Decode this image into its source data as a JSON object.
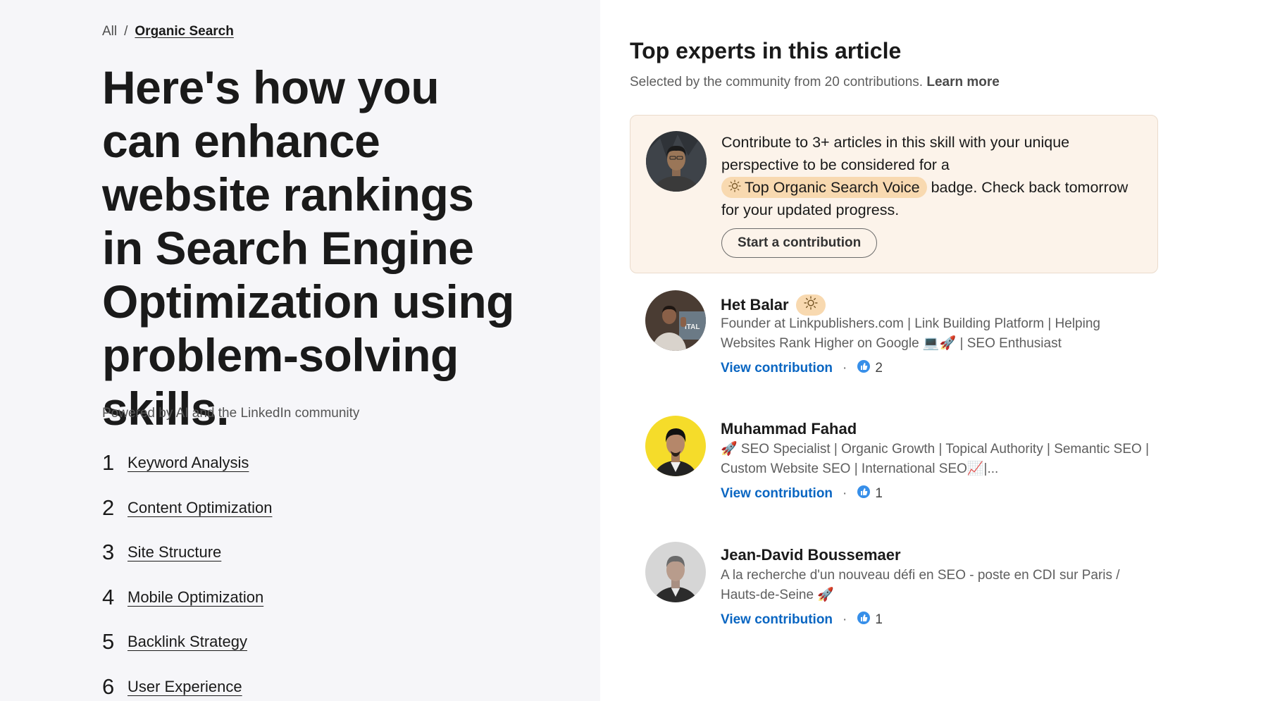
{
  "breadcrumb": {
    "root": "All",
    "separator": "/",
    "current": "Organic Search"
  },
  "article": {
    "title": "Here's how you can enhance website rankings in Search Engine Optimization using problem-solving skills.",
    "powered_by": "Powered by AI and the LinkedIn community"
  },
  "toc": [
    {
      "num": "1",
      "label": "Keyword Analysis"
    },
    {
      "num": "2",
      "label": "Content Optimization"
    },
    {
      "num": "3",
      "label": "Site Structure"
    },
    {
      "num": "4",
      "label": "Mobile Optimization"
    },
    {
      "num": "5",
      "label": "Backlink Strategy"
    },
    {
      "num": "6",
      "label": "User Experience"
    }
  ],
  "experts_panel": {
    "title": "Top experts in this article",
    "subtitle": "Selected by the community from 20 contributions.",
    "learn_more": "Learn more"
  },
  "promo": {
    "text_before": "Contribute to 3+ articles in this skill with your unique perspective to be considered for a",
    "badge_label": "Top Organic Search Voice",
    "badge_icon": "lightbulb-icon",
    "text_after": "badge. Check back tomorrow for your updated progress.",
    "button_label": "Start a contribution"
  },
  "experts": [
    {
      "name": "Het Balar",
      "has_badge": true,
      "headline": "Founder at Linkpublishers.com | Link Building Platform | Helping Websites Rank Higher on Google 💻🚀 | SEO Enthusiast",
      "view_label": "View contribution",
      "likes": "2"
    },
    {
      "name": "Muhammad Fahad",
      "has_badge": false,
      "headline": "🚀 SEO Specialist | Organic Growth | Topical Authority | Semantic SEO | Custom Website SEO | International SEO📈|...",
      "view_label": "View contribution",
      "likes": "1"
    },
    {
      "name": "Jean-David Boussemaer",
      "has_badge": false,
      "headline": "A la recherche d'un nouveau défi en SEO - poste en CDI sur Paris / Hauts-de-Seine 🚀",
      "view_label": "View contribution",
      "likes": "1"
    }
  ],
  "colors": {
    "left_bg": "#f6f6f9",
    "promo_bg": "#fcf3ea",
    "badge_bg": "#f8d9b0",
    "link_blue": "#0a66c2"
  }
}
